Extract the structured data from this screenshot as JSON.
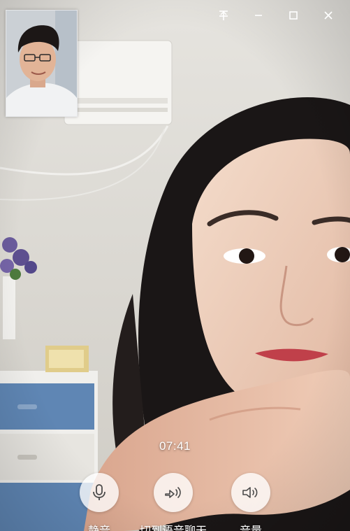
{
  "window": {
    "controls": [
      {
        "name": "pin-icon"
      },
      {
        "name": "minimize-icon"
      },
      {
        "name": "maximize-icon"
      },
      {
        "name": "close-icon"
      }
    ]
  },
  "call": {
    "timer": "07:41",
    "controls": [
      {
        "label": "静音",
        "icon": "microphone-icon"
      },
      {
        "label": "切到语音聊天",
        "icon": "switch-to-voice-icon"
      },
      {
        "label": "音量",
        "icon": "speaker-volume-icon"
      }
    ]
  }
}
